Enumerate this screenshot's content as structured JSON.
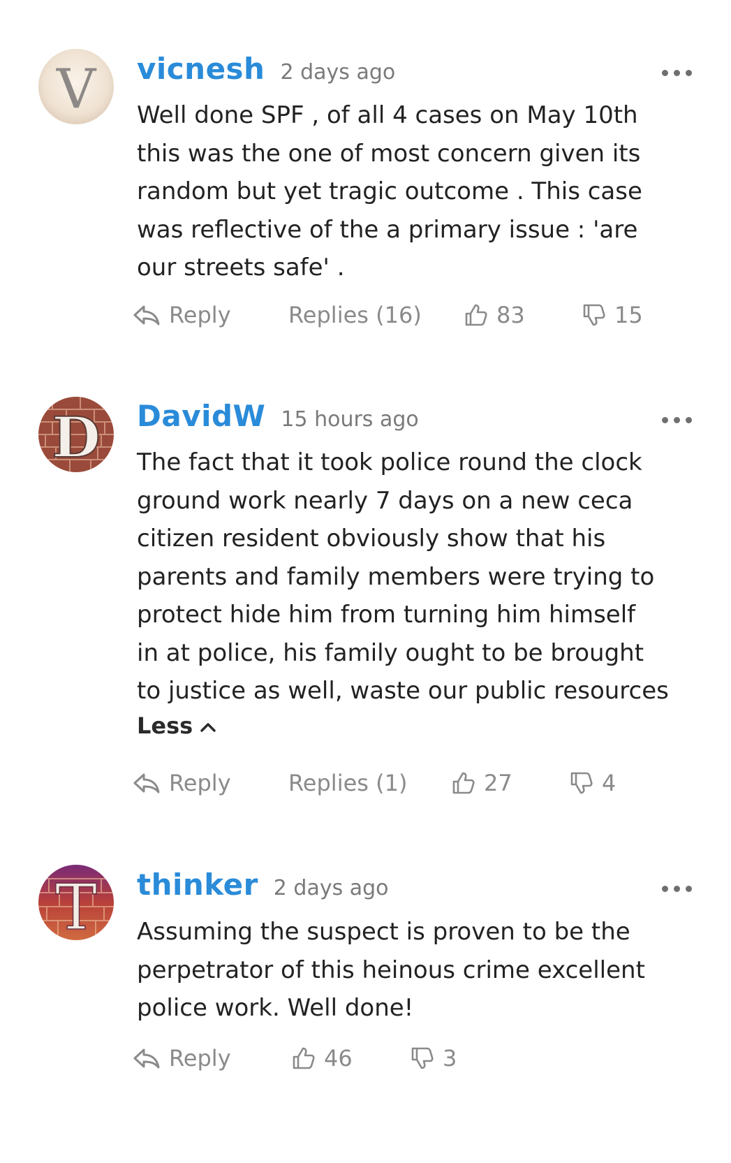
{
  "colors": {
    "username": "#2a8bd9",
    "timestamp": "#7a7a7a",
    "action": "#8a8a8a",
    "body": "#222222"
  },
  "comments": [
    {
      "avatar_letter": "V",
      "username": "vicnesh",
      "time": "2 days ago",
      "body": "Well done SPF , of all 4 cases on May 10th\nthis was the one of most concern given its\nrandom but yet tragic outcome . This case\nwas reflective of the a primary issue : 'are\nour streets safe' .",
      "reply_label": "Reply",
      "replies_label": "Replies (16)",
      "likes": "83",
      "dislikes": "15"
    },
    {
      "avatar_letter": "D",
      "username": "DavidW",
      "time": "15 hours ago",
      "body": "The fact that it took police round the clock\nground work nearly 7 days on a new ceca\ncitizen resident obviously show that his\nparents and family members were trying to\nprotect hide him from turning him himself\nin at police, his family ought to be brought\nto justice as well, waste our public resources",
      "less_label": "Less",
      "reply_label": "Reply",
      "replies_label": "Replies (1)",
      "likes": "27",
      "dislikes": "4"
    },
    {
      "avatar_letter": "T",
      "username": "thinker",
      "time": "2 days ago",
      "body": "Assuming the suspect is proven to be the\nperpetrator of this heinous crime excellent\npolice work. Well done!",
      "reply_label": "Reply",
      "likes": "46",
      "dislikes": "3"
    }
  ],
  "icons": {
    "avatar": "avatar",
    "more": "more-horizontal-icon",
    "reply": "reply-arrow-icon",
    "like": "thumbs-up-icon",
    "dislike": "thumbs-down-icon",
    "collapse": "chevron-up-icon"
  }
}
